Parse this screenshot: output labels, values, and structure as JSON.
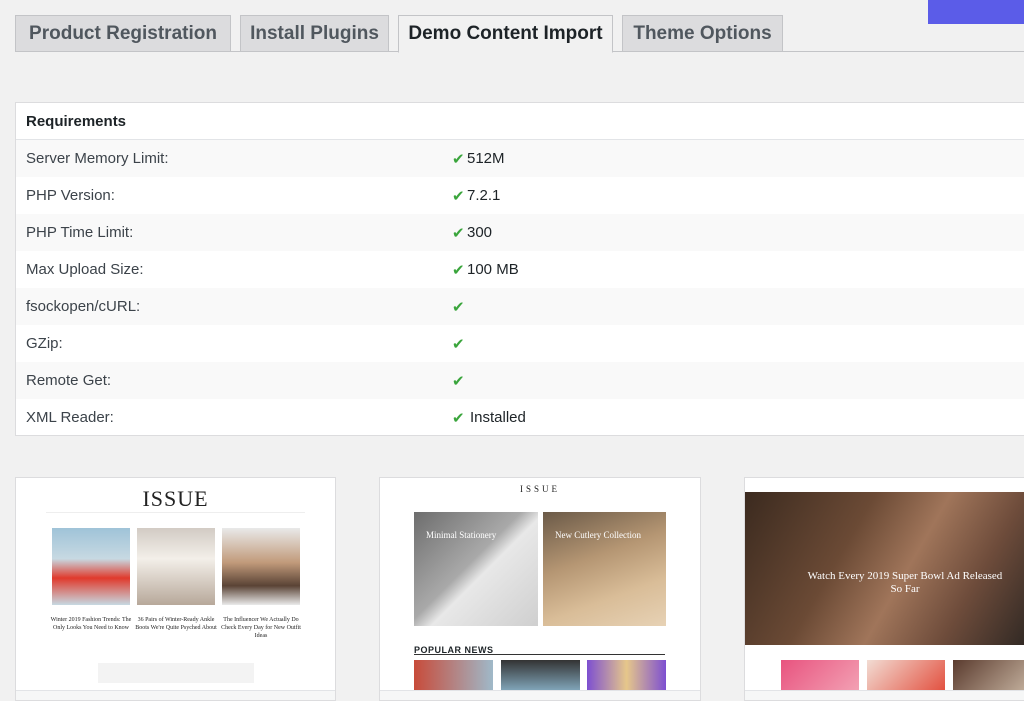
{
  "tabs": [
    {
      "label": "Product Registration",
      "active": false
    },
    {
      "label": "Install Plugins",
      "active": false
    },
    {
      "label": "Demo Content Import",
      "active": true
    },
    {
      "label": "Theme Options",
      "active": false
    }
  ],
  "requirements": {
    "heading": "Requirements",
    "rows": [
      {
        "label": "Server Memory Limit:",
        "value": "512M",
        "ok": true
      },
      {
        "label": "PHP Version:",
        "value": "7.2.1",
        "ok": true
      },
      {
        "label": "PHP Time Limit:",
        "value": "300",
        "ok": true
      },
      {
        "label": "Max Upload Size:",
        "value": "100 MB",
        "ok": true
      },
      {
        "label": "fsockopen/cURL:",
        "value": "",
        "ok": true
      },
      {
        "label": "GZip:",
        "value": "",
        "ok": true
      },
      {
        "label": "Remote Get:",
        "value": "",
        "ok": true
      },
      {
        "label": "XML Reader:",
        "value": "Installed",
        "ok": true
      }
    ]
  },
  "demos": [
    {
      "logo": "ISSUE",
      "captions": [
        "Winter 2019 Fashion Trends: The Only Looks You Need to Know",
        "36 Pairs of Winter-Ready Ankle Boots We're Quite Psyched About",
        "The Influencer We Actually Do Check Every Day for New Outfit Ideas"
      ]
    },
    {
      "logo": "ISSUE",
      "cards": [
        "Minimal Stationery",
        "New Cutlery Collection"
      ],
      "section_title": "POPULAR NEWS"
    },
    {
      "hero_title": "Watch Every 2019 Super Bowl Ad Released So Far"
    }
  ],
  "colors": {
    "accent": "#5b5ce8",
    "check": "#3aa53c"
  },
  "icons": {
    "check": "checkmark-icon"
  }
}
